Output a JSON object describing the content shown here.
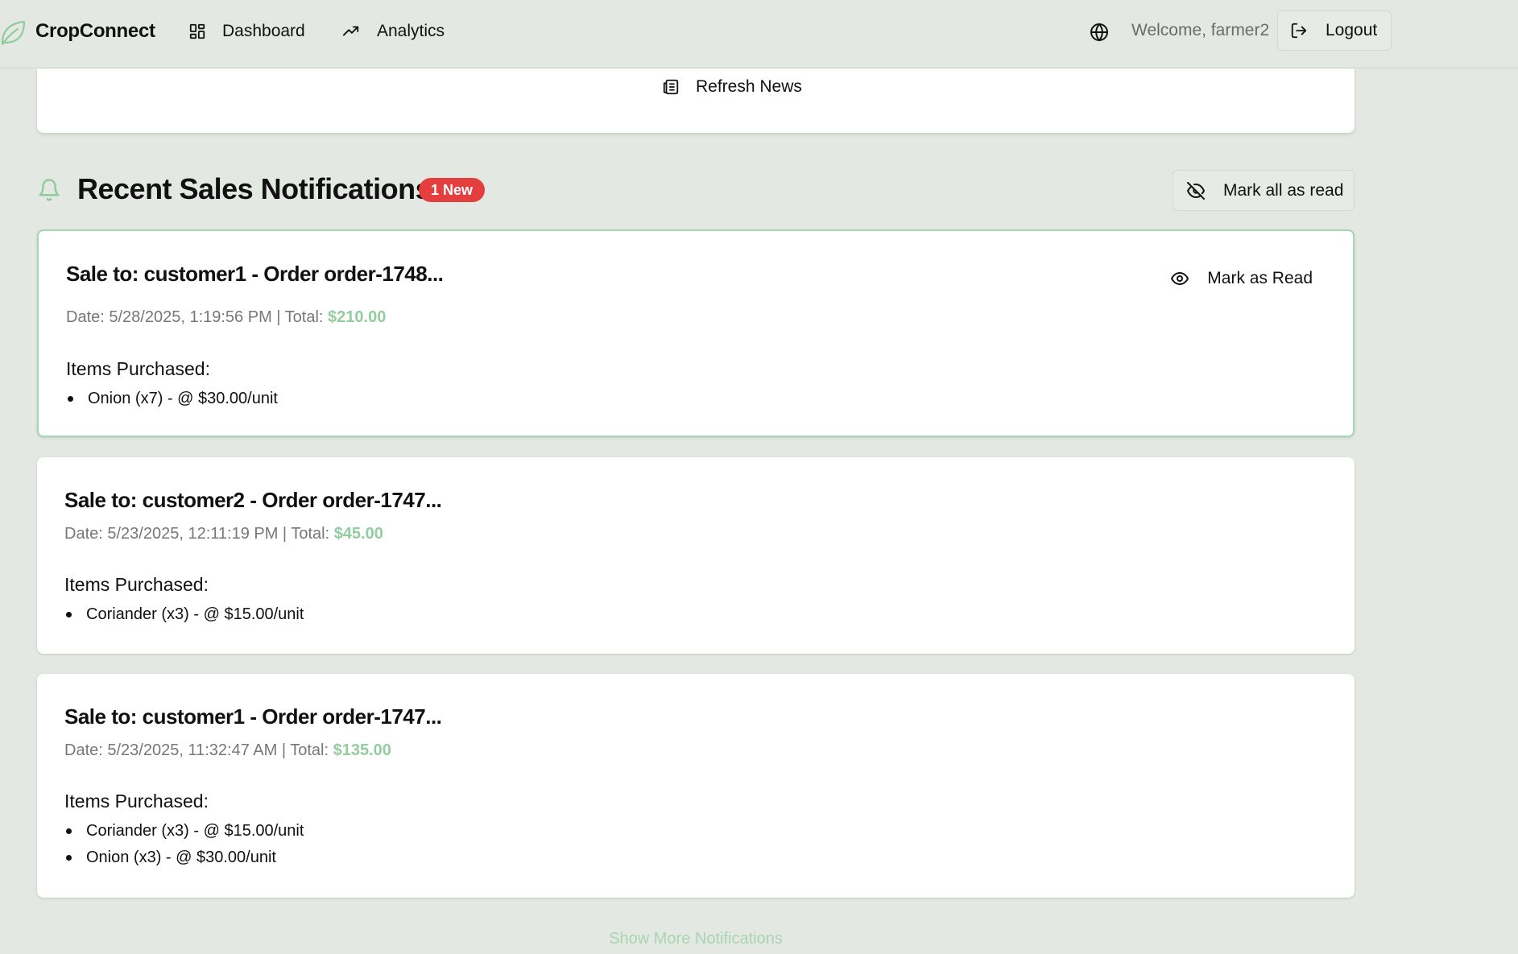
{
  "app": {
    "name": "CropConnect",
    "brand_color": "#8fcb9b"
  },
  "nav": {
    "dashboard_label": "Dashboard",
    "analytics_label": "Analytics",
    "language_icon": "globe-icon",
    "welcome_text": "Welcome, farmer2",
    "logout_label": "Logout"
  },
  "news": {
    "refresh_label": "Refresh News"
  },
  "notifications": {
    "title": "Recent Sales Notifications",
    "new_badge": "1 New",
    "mark_all_label": "Mark all as read",
    "mark_read_label": "Mark as Read",
    "items_label": "Items Purchased:",
    "show_more_label": "Show More Notifications",
    "list": [
      {
        "title": "Sale to: customer1 - Order order-1748...",
        "date_prefix": "Date: 5/28/2025, 1:19:56 PM | Total: ",
        "total": "$210.00",
        "unread": true,
        "items": [
          "Onion (x7) - @ $30.00/unit"
        ]
      },
      {
        "title": "Sale to: customer2 - Order order-1747...",
        "date_prefix": "Date: 5/23/2025, 12:11:19 PM | Total: ",
        "total": "$45.00",
        "unread": false,
        "items": [
          "Coriander (x3) - @ $15.00/unit"
        ]
      },
      {
        "title": "Sale to: customer1 - Order order-1747...",
        "date_prefix": "Date: 5/23/2025, 11:32:47 AM | Total: ",
        "total": "$135.00",
        "unread": false,
        "items": [
          "Coriander (x3) - @ $15.00/unit",
          "Onion (x3) - @ $30.00/unit"
        ]
      }
    ]
  },
  "colors": {
    "page_bg": "#e3e9e2",
    "badge_red": "#e53e3e",
    "total_green": "#93cc9f",
    "unread_border": "#a8d5b2"
  }
}
